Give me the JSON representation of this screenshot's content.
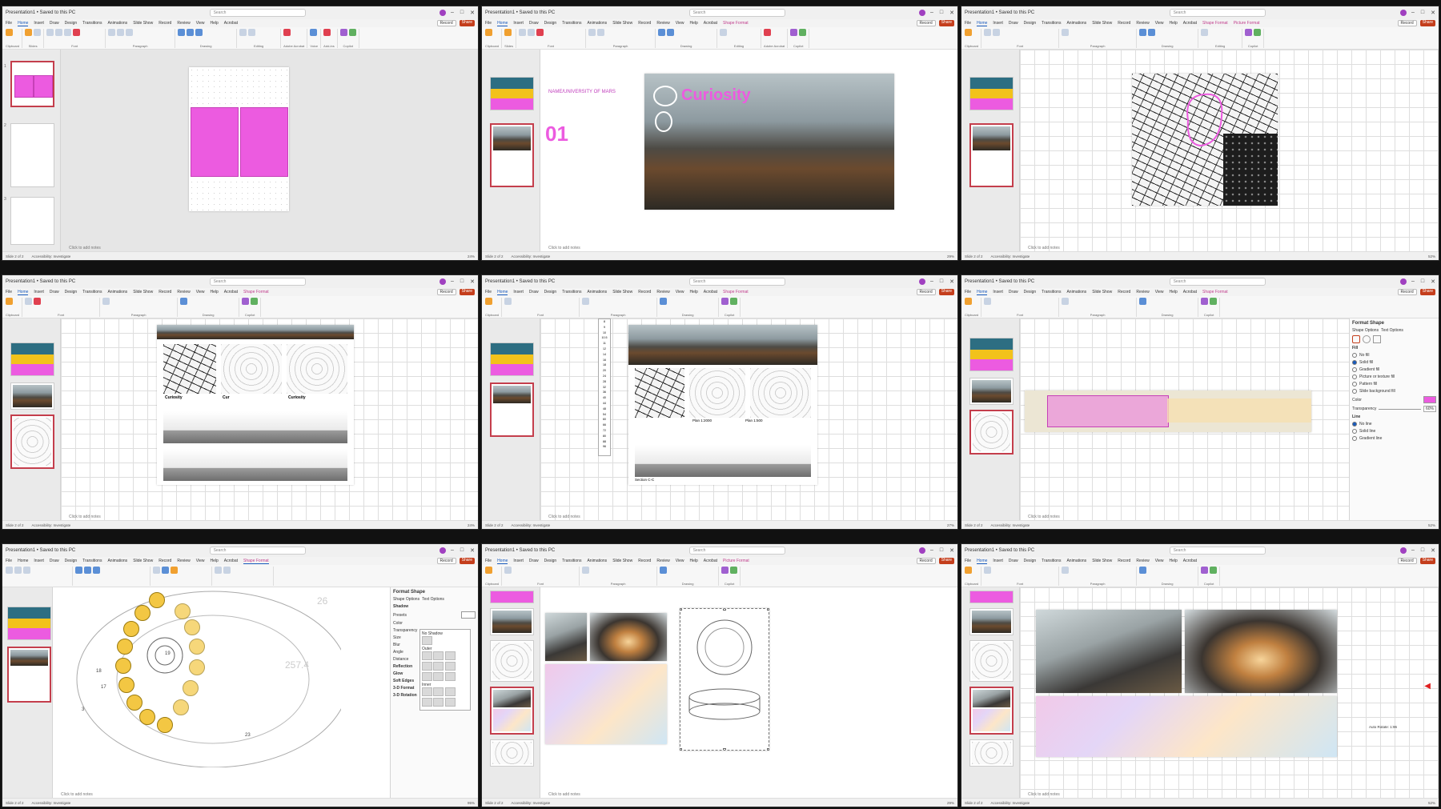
{
  "app": {
    "title": "Presentation1 • Saved to this PC",
    "search_placeholder": "Search",
    "record_label": "Record",
    "share_label": "Share",
    "notes_placeholder": "Click to add notes",
    "slide_status": "Slide 2 of 2",
    "accessibility": "Accessibility: Investigate",
    "notes_btn": "Notes"
  },
  "tabs": [
    "File",
    "Home",
    "Insert",
    "Draw",
    "Design",
    "Transitions",
    "Animations",
    "Slide Show",
    "Record",
    "Review",
    "View",
    "Help",
    "Acrobat"
  ],
  "contextual_tabs": {
    "shape_format": "Shape Format",
    "picture_format": "Picture Format"
  },
  "ribbon_groups": [
    "Clipboard",
    "Slides",
    "Font",
    "Paragraph",
    "Drawing",
    "Editing",
    "Adobe Acrobat",
    "Voice",
    "Add-ins",
    "Designer",
    "Copilot"
  ],
  "windows": [
    {
      "id": "w1",
      "zoom": "24%",
      "thumb_labels": [
        "1",
        "2",
        "3"
      ]
    },
    {
      "id": "w2",
      "slide_text_university": "NAME/UNIVERSITY OF MARS",
      "slide_text_number": "01",
      "slide_text_title": "Curiosity",
      "zoom": "29%"
    },
    {
      "id": "w3",
      "zoom": "52%"
    },
    {
      "id": "w4",
      "labels": [
        "Curiosity",
        "Cur",
        "Curiosity"
      ],
      "zoom": "24%"
    },
    {
      "id": "w5",
      "labels": [
        "Plan 1:2000",
        "Plan 1:500",
        "Section C-C"
      ],
      "font_sizes": [
        "8",
        "9",
        "10",
        "10.5",
        "11",
        "12",
        "14",
        "16",
        "18",
        "20",
        "24",
        "28",
        "32",
        "36",
        "40",
        "44",
        "48",
        "54",
        "60",
        "66",
        "72",
        "80",
        "88",
        "96"
      ],
      "zoom": "27%"
    },
    {
      "id": "w6",
      "pane_title": "Format Shape",
      "pane_tabs": [
        "Shape Options",
        "Text Options"
      ],
      "fill_header": "Fill",
      "fill_options": [
        "No fill",
        "Solid fill",
        "Gradient fill",
        "Picture or texture fill",
        "Pattern fill",
        "Slide background fill"
      ],
      "color_label": "Color",
      "transparency_label": "Transparency",
      "transparency_value": "60%",
      "line_header": "Line",
      "line_options": [
        "No line",
        "Solid line",
        "Gradient line"
      ],
      "zoom": "52%"
    },
    {
      "id": "w7",
      "pane_title": "Format Shape",
      "pane_tabs": [
        "Shape Options",
        "Text Options"
      ],
      "shadow_header": "Shadow",
      "presets_label": "Presets",
      "shadow_rows": [
        "Color",
        "Transparency",
        "Size",
        "Blur",
        "Angle",
        "Distance"
      ],
      "no_shadow": "No Shadow",
      "outer_label": "Outer",
      "inner_label": "Inner",
      "more_sections": [
        "Reflection",
        "Glow",
        "Soft Edges",
        "3-D Format",
        "3-D Rotation"
      ],
      "plan_numbers": [
        "18",
        "19",
        "17",
        "3",
        "23",
        "26",
        "257.4"
      ],
      "zoom": "95%"
    },
    {
      "id": "w8",
      "zoom": "29%"
    },
    {
      "id": "w9",
      "scale_label": "Auto Rotate: 1:96",
      "zoom": "52%"
    }
  ],
  "colors": {
    "accent": "#185abd",
    "magenta": "#ec5be0",
    "teal": "#2d6e82",
    "yellow": "#f2c21b",
    "share": "#c43e1c"
  }
}
